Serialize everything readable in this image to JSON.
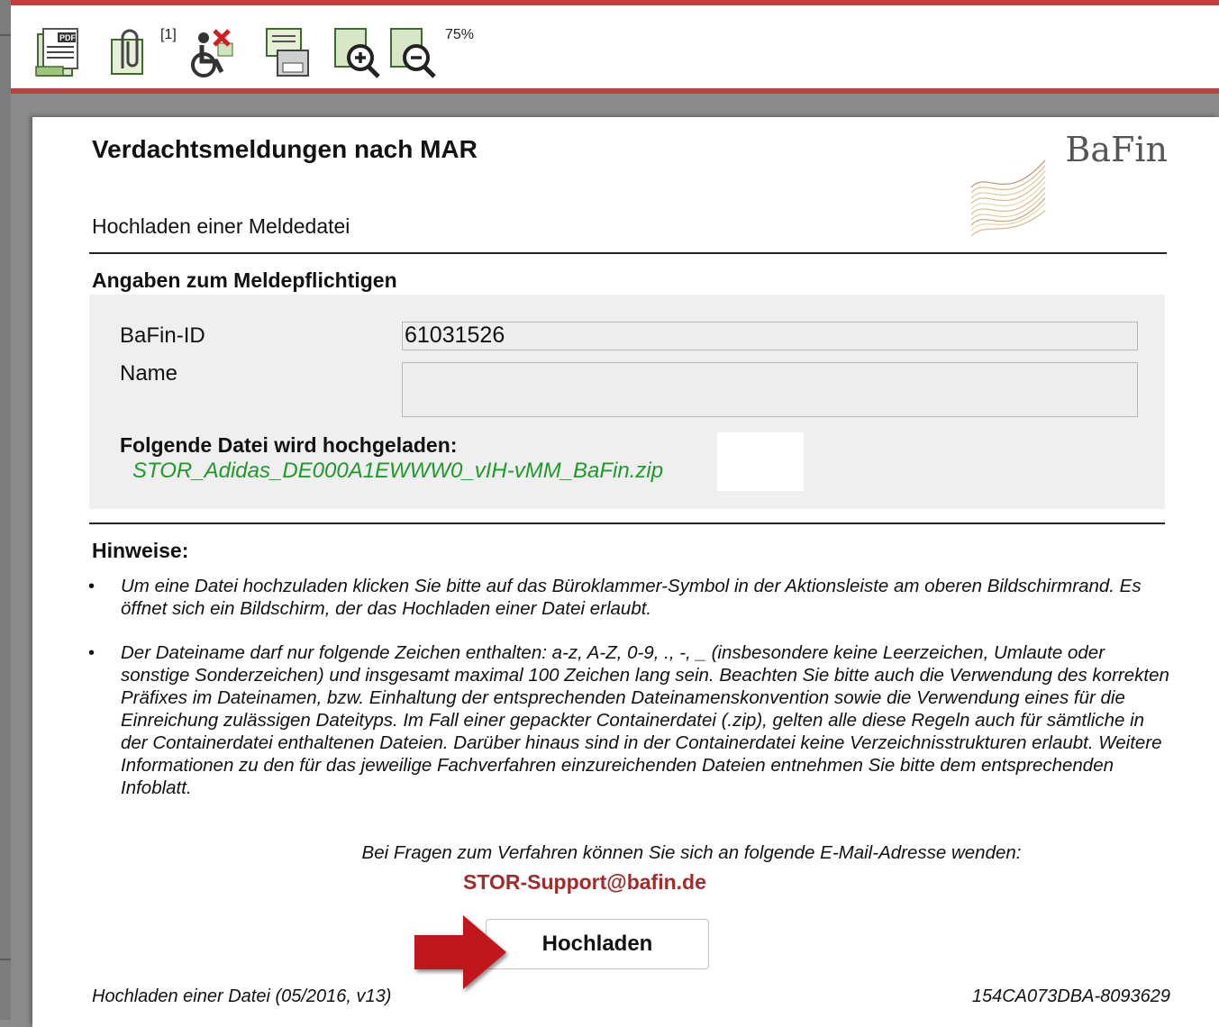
{
  "toolbar": {
    "pdf_icon_text": "PDF",
    "attachment_count": "[1]",
    "zoom_level": "75%"
  },
  "page": {
    "title": "Verdachtsmeldungen nach MAR",
    "logo_text": "BaFin",
    "subtitle": "Hochladen einer Meldedatei",
    "section_title": "Angaben zum Meldepflichtigen",
    "fields": {
      "bafin_id_label": "BaFin-ID",
      "bafin_id_value": "61031526",
      "name_label": "Name",
      "name_value": ""
    },
    "upload": {
      "heading": "Folgende Datei wird hochgeladen:",
      "filename": "STOR_Adidas_DE000A1EWWW0_vIH-vMM_BaFin.zip"
    },
    "hints": {
      "title": "Hinweise:",
      "bullet": "•",
      "items": [
        "Um eine Datei hochzuladen klicken Sie bitte auf das Büroklammer-Symbol in der Aktionsleiste am oberen Bildschirmrand. Es öffnet sich ein Bildschirm, der das Hochladen einer Datei erlaubt.",
        "Der Dateiname darf nur folgende Zeichen enthalten: a-z, A-Z, 0-9, ., -, _ (insbesondere keine Leerzeichen, Umlaute oder sonstige Sonderzeichen) und insgesamt maximal 100 Zeichen lang sein. Beachten Sie bitte auch die Verwendung des korrekten Präfixes im Dateinamen, bzw. Einhaltung der entsprechenden Dateinamenskonvention sowie die Verwendung eines für die Einreichung zulässigen Dateityps. Im Fall einer gepackter Containerdatei (.zip), gelten alle diese Regeln auch für sämtliche in der Containerdatei enthaltenen Dateien. Darüber hinaus sind in der Containerdatei keine Verzeichnisstrukturen erlaubt. Weitere Informationen zu den für das jeweilige Fachverfahren einzureichenden Dateien entnehmen Sie bitte dem entsprechenden Infoblatt."
      ]
    },
    "contact": {
      "text": "Bei Fragen zum Verfahren können Sie sich an folgende E-Mail-Adresse wenden:",
      "email": "STOR-Support@bafin.de"
    },
    "upload_button_label": "Hochladen",
    "footer_left": "Hochladen einer Datei (05/2016, v13)",
    "footer_right": "154CA073DBA-8093629"
  },
  "colors": {
    "toolbar_border": "#bf3f3f",
    "filename_green": "#1f9a2a",
    "email_red": "#a12b2b",
    "arrow_red": "#c0141a"
  },
  "icons": [
    "export-pdf-icon",
    "attachment-icon",
    "accessibility-icon",
    "print-icon",
    "zoom-in-icon",
    "zoom-out-icon",
    "bafin-logo-icon",
    "arrow-right-icon"
  ]
}
